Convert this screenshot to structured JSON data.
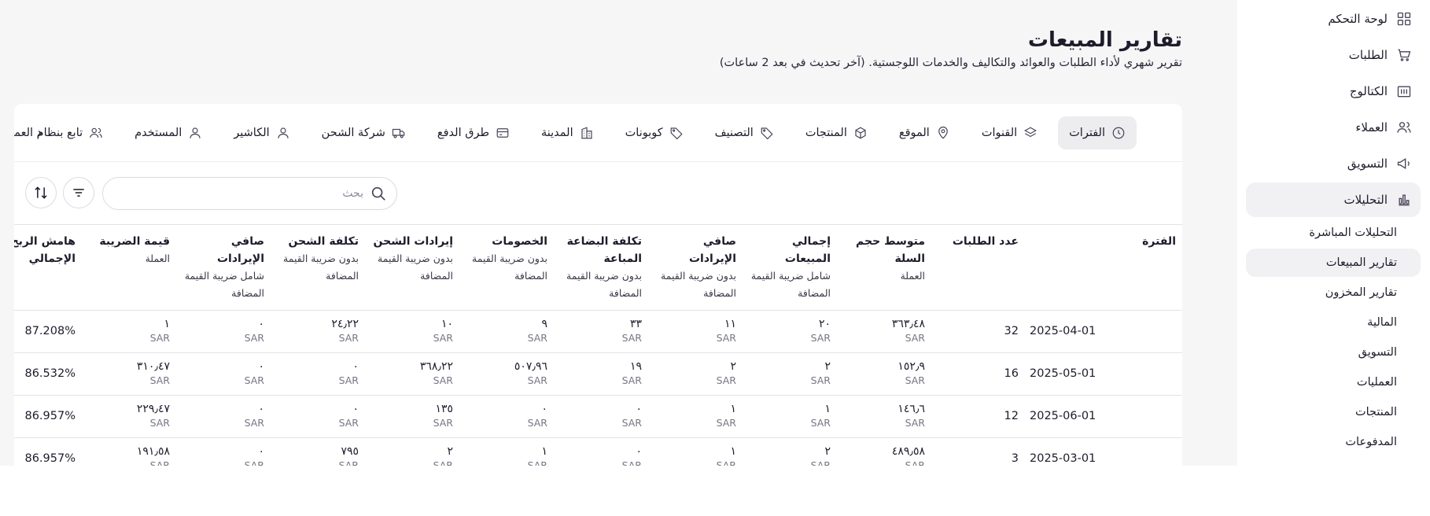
{
  "sidebar": {
    "items": [
      {
        "label": "لوحة التحكم",
        "icon": "dashboard-icon"
      },
      {
        "label": "الطلبات",
        "icon": "cart-icon"
      },
      {
        "label": "الكتالوج",
        "icon": "catalog-icon"
      },
      {
        "label": "العملاء",
        "icon": "users-icon"
      },
      {
        "label": "التسويق",
        "icon": "megaphone-icon"
      },
      {
        "label": "التحليلات",
        "icon": "chart-icon",
        "active": true
      }
    ],
    "sub_items": [
      {
        "label": "التحليلات المباشرة"
      },
      {
        "label": "تقارير المبيعات",
        "active": true
      },
      {
        "label": "تقارير المخزون"
      },
      {
        "label": "المالية"
      },
      {
        "label": "التسويق"
      },
      {
        "label": "العمليات"
      },
      {
        "label": "المنتجات"
      },
      {
        "label": "المدفوعات"
      }
    ]
  },
  "header": {
    "title": "تقارير المبيعات",
    "subtitle": "تقرير شهري لأداء الطلبات والعوائد والتكاليف والخدمات اللوجستية. (آخر تحديث في بعد 2 ساعات)"
  },
  "tabs": [
    {
      "label": "الفترات",
      "icon": "clock-icon",
      "active": true
    },
    {
      "label": "القنوات",
      "icon": "layers-icon"
    },
    {
      "label": "الموقع",
      "icon": "location-icon"
    },
    {
      "label": "المنتجات",
      "icon": "box-icon"
    },
    {
      "label": "التصنيف",
      "icon": "tag-icon"
    },
    {
      "label": "كوبونات",
      "icon": "coupon-icon"
    },
    {
      "label": "المدينة",
      "icon": "building-icon"
    },
    {
      "label": "طرق الدفع",
      "icon": "credit-card-icon"
    },
    {
      "label": "شركة الشحن",
      "icon": "truck-icon"
    },
    {
      "label": "الكاشير",
      "icon": "person-icon"
    },
    {
      "label": "المستخدم",
      "icon": "user-icon"
    },
    {
      "label": "تابع بنظام العمولة",
      "icon": "affiliate-icon"
    }
  ],
  "search": {
    "placeholder": "بحث"
  },
  "table": {
    "columns": [
      {
        "title": "الفترة",
        "sub": ""
      },
      {
        "title": "عدد الطلبات",
        "sub": ""
      },
      {
        "title": "متوسط حجم السلة",
        "sub": "العملة"
      },
      {
        "title": "إجمالي المبيعات",
        "sub": "شامل ضريبة القيمة المضافة"
      },
      {
        "title": "صافي الإيرادات",
        "sub": "بدون ضريبة القيمة المضافة"
      },
      {
        "title": "تكلفة البضاعة المباعة",
        "sub": "بدون ضريبة القيمة المضافة"
      },
      {
        "title": "الخصومات",
        "sub": "بدون ضريبة القيمة المضافة"
      },
      {
        "title": "إيرادات الشحن",
        "sub": "بدون ضريبة القيمة المضافة"
      },
      {
        "title": "تكلفة الشحن",
        "sub": "بدون ضريبة القيمة المضافة"
      },
      {
        "title": "صافي الإيرادات",
        "sub": "شامل ضريبة القيمة المضافة"
      },
      {
        "title": "قيمة الضريبة",
        "sub": "العملة"
      },
      {
        "title": "هامش الربح الإجمالي",
        "sub": ""
      }
    ],
    "currency": "SAR",
    "rows": [
      {
        "period": "2025-04-01",
        "orders": "32",
        "vals": [
          "٣٦٣٫٤٨",
          "٢٠",
          "١١",
          "٣٣",
          "٩",
          "١٠",
          "٢٤٫٢٢",
          "٠",
          "١"
        ],
        "margin": "87.208%"
      },
      {
        "period": "2025-05-01",
        "orders": "16",
        "vals": [
          "١٥٢٫٩",
          "٢",
          "٢",
          "١٩",
          "٥٠٧٫٩٦",
          "٣٦٨٫٢٢",
          "٠",
          "٠",
          "٣١٠٫٤٧"
        ],
        "margin": "86.532%"
      },
      {
        "period": "2025-06-01",
        "orders": "12",
        "vals": [
          "١٤٦٫٦",
          "١",
          "١",
          "٠",
          "٠",
          "١٣٥",
          "٠",
          "٠",
          "٢٢٩٫٤٧"
        ],
        "margin": "86.957%"
      },
      {
        "period": "2025-03-01",
        "orders": "3",
        "vals": [
          "٤٨٩٫٥٨",
          "٢",
          "١",
          "٠",
          "١",
          "٢",
          "٧٩٥",
          "٠",
          "١٩١٫٥٨"
        ],
        "margin": "86.957%"
      }
    ]
  },
  "colors": {
    "page_bg": "#f6f6f7",
    "card_bg": "#ffffff",
    "active_bg": "#ededf0",
    "text": "#1f1b2b",
    "muted": "#7a7585"
  }
}
